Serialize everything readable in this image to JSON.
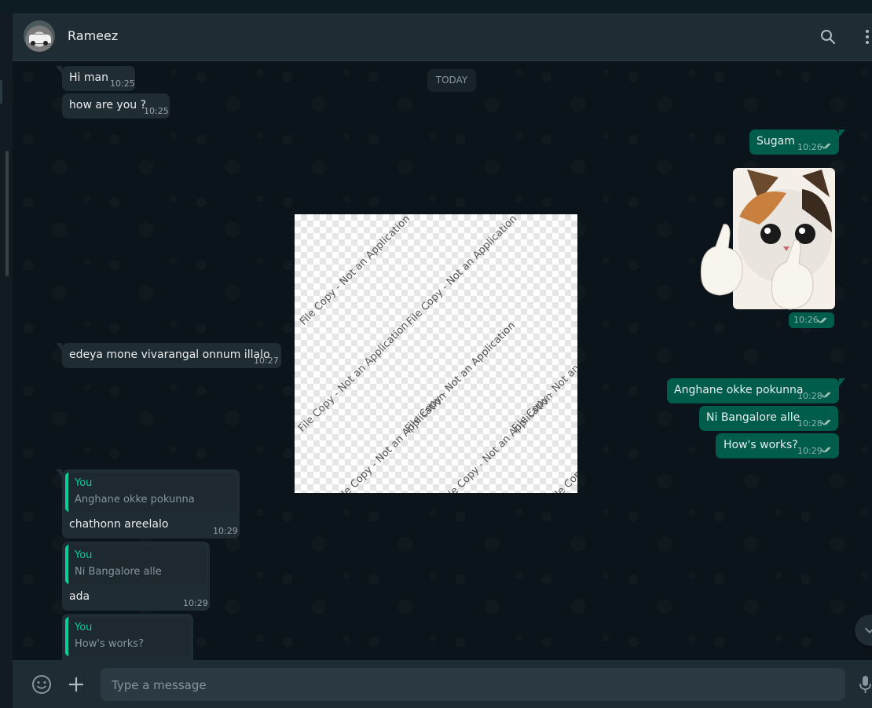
{
  "header": {
    "contact_name": "Rameez",
    "icons": [
      "search-icon",
      "menu-icon"
    ]
  },
  "chat": {
    "date_label": "TODAY",
    "messages": [
      {
        "dir": "in",
        "text": "Hi man",
        "time": "10:25"
      },
      {
        "dir": "in",
        "text": "how are you ?",
        "time": "10:25"
      },
      {
        "dir": "out",
        "text": "Sugam",
        "time": "10:26",
        "status": "read"
      },
      {
        "dir": "out",
        "type": "sticker",
        "sticker": "crying-cat-thumbs-up",
        "time": "10:26",
        "status": "read"
      },
      {
        "dir": "in",
        "text": "edeya mone vivarangal onnum illalo",
        "time": "10:27"
      },
      {
        "dir": "out",
        "text": "Anghane okke pokunna",
        "time": "10:28",
        "status": "read"
      },
      {
        "dir": "out",
        "text": "Ni Bangalore alle",
        "time": "10:28",
        "status": "read"
      },
      {
        "dir": "out",
        "text": "How's works?",
        "time": "10:29",
        "status": "read"
      },
      {
        "dir": "in",
        "reply_to": {
          "author": "You",
          "text": "Anghane okke pokunna"
        },
        "text": "chathonn areelalo",
        "time": "10:29"
      },
      {
        "dir": "in",
        "reply_to": {
          "author": "You",
          "text": "Ni Bangalore alle"
        },
        "text": "ada",
        "time": "10:29"
      },
      {
        "dir": "in",
        "reply_to": {
          "author": "You",
          "text": "How's works?"
        },
        "text": "",
        "time": ""
      }
    ]
  },
  "overlay": {
    "watermark": "File Copy - Not an Application"
  },
  "composer": {
    "placeholder": "Type a message",
    "icons": [
      "emoji-icon",
      "plus-icon",
      "mic-icon"
    ]
  },
  "colors": {
    "incoming_bubble": "#202c33",
    "outgoing_bubble": "#005c4b",
    "accent": "#06cf9c",
    "background": "#0b141a"
  }
}
